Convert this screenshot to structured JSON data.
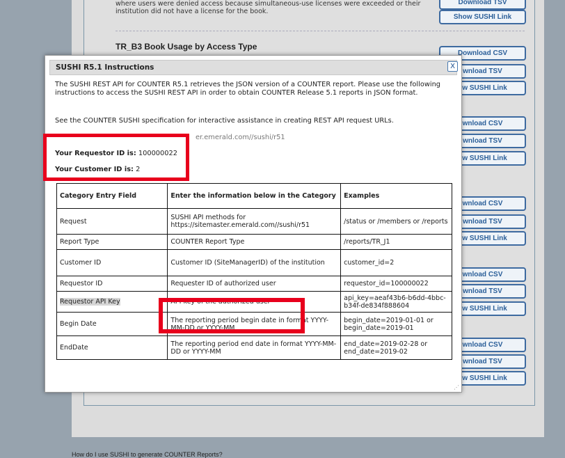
{
  "background": {
    "top_text": "where users were denied access because simultaneous-use licenses were exceeded or their institution did not have a license for the book.",
    "section_title": "TR_B3 Book Usage by Access Type",
    "buttons": [
      {
        "label": "Download TSV"
      },
      {
        "label": "Show SUSHI Link"
      },
      {
        "label": "Download CSV"
      },
      {
        "label": "wnload TSV"
      },
      {
        "label": "ow SUSHI Link"
      },
      {
        "label": "wnload CSV"
      },
      {
        "label": "wnload TSV"
      },
      {
        "label": "ow SUSHI Link"
      },
      {
        "label": "wnload CSV"
      },
      {
        "label": "wnload TSV"
      },
      {
        "label": "ow SUSHI Link"
      },
      {
        "label": "wnload CSV"
      },
      {
        "label": "wnload TSV"
      },
      {
        "label": "ow SUSHI Link"
      },
      {
        "label": "wnload CSV"
      },
      {
        "label": "wnload TSV"
      },
      {
        "label": "ow SUSHI Link"
      }
    ],
    "footer_question": "How do I use SUSHI to generate COUNTER Reports?"
  },
  "dialog": {
    "title": "SUSHI R5.1 Instructions",
    "close_label": "X",
    "intro": "The SUSHI REST API for COUNTER R5.1 retrieves the JSON version of a COUNTER report. Please use the following instructions to access the SUSHI REST API in order to obtain COUNTER Release 5.1 reports in JSON format.",
    "spec_text": "See the COUNTER SUSHI specification for interactive assistance in creating REST API request URLs.",
    "url_text": "er.emerald.com//sushi/r51",
    "requestor_label": "Your Requestor ID is:",
    "requestor_value": "100000022",
    "customer_label": "Your Customer ID is:",
    "customer_value": "2",
    "table": {
      "headers": [
        "Category Entry Field",
        "Enter the information below in the Category",
        "Examples"
      ],
      "rows": [
        [
          "Request",
          "SUSHI API methods for https://sitemaster.emerald.com//sushi/r51",
          "/status or /members or /reports"
        ],
        [
          "Report Type",
          "COUNTER Report Type",
          "/reports/TR_J1"
        ],
        [
          "Customer ID",
          "Customer ID (SiteManagerID) of the institution",
          "customer_id=2"
        ],
        [
          "Requestor ID",
          "Requester ID of authorized user",
          "requestor_id=100000022"
        ],
        [
          "Requestor API Key",
          "API key of the authorized user",
          "api_key=aeaf43b6-b6dd-4bbc-b34f-de834f888604"
        ],
        [
          "Begin Date",
          "The reporting period begin date in format YYYY-MM-DD or YYYY-MM",
          "begin_date=2019-01-01 or begin_date=2019-01"
        ],
        [
          "EndDate",
          "The reporting period end date in format YYYY-MM-DD or YYYY-MM",
          "end_date=2019-02-28 or end_date=2019-02"
        ]
      ]
    }
  },
  "colors": {
    "highlight_red": "#e8001c",
    "button_blue": "#3d6aa0"
  }
}
